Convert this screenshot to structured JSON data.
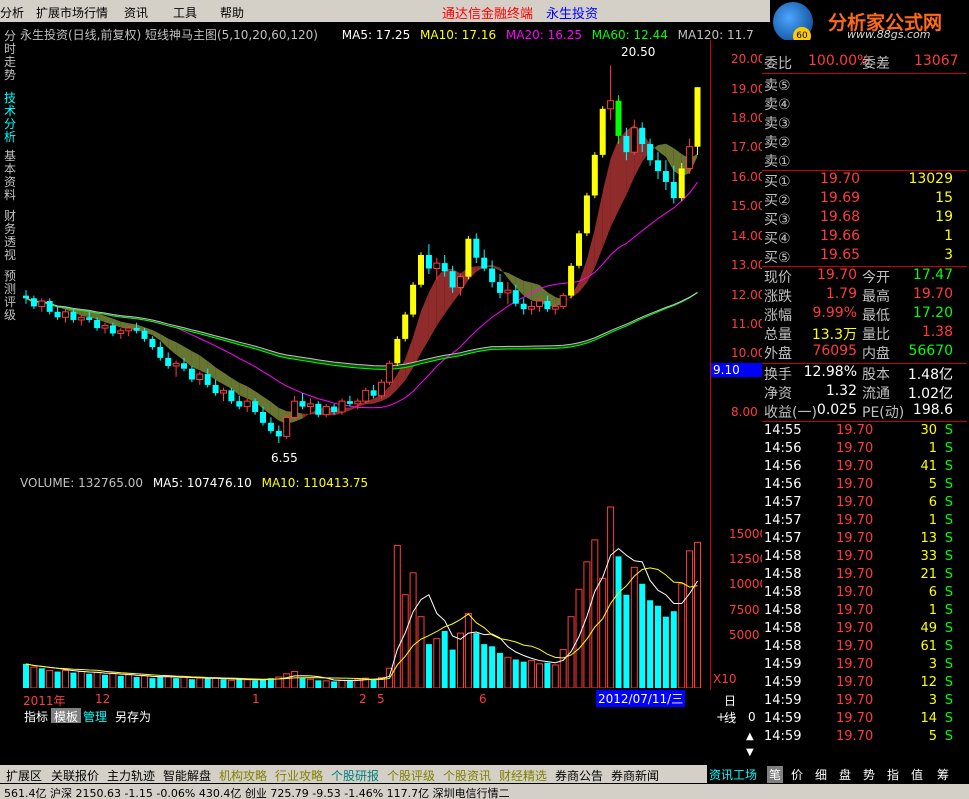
{
  "menu": {
    "items": [
      "分析",
      "扩展市场行情",
      "资讯",
      "工具",
      "帮助"
    ],
    "promo1": "通达信金融终端",
    "promo2": "永生投资"
  },
  "logo": {
    "text": "分析家公式网",
    "url": "www.88gs.com",
    "badge": "60"
  },
  "left_tabs": [
    "分时走势",
    "技术分析",
    "基本资料",
    "财务透视",
    "预测评级"
  ],
  "chart_header": {
    "title": "永生投资(日线,前复权) 短线神马主图(5,10,20,60,120)",
    "ma5": "MA5: 17.25",
    "ma10": "MA10: 17.16",
    "ma20": "MA20: 16.25",
    "ma60": "MA60: 12.44",
    "ma120": "MA120: 11.7",
    "ma_colors": {
      "ma5": "#ffffff",
      "ma10": "#ffff00",
      "ma20": "#ff00ff",
      "ma60": "#00ff00",
      "ma120": "#c0c0c0"
    }
  },
  "annotations": {
    "high": "20.50",
    "low": "6.55"
  },
  "volume_header": {
    "volume": "VOLUME: 132765.00",
    "ma5": "MA5: 107476.10",
    "ma10": "MA10: 110413.75"
  },
  "price_axis": [
    "20.00",
    "19.00",
    "18.00",
    "17.00",
    "16.00",
    "15.00",
    "14.00",
    "13.00",
    "12.00",
    "11.00",
    "10.00",
    "9.10",
    "8.00"
  ],
  "cursor_price": "9.10",
  "volume_axis": [
    "15000",
    "12500",
    "10000",
    "7500",
    "5000",
    "X10"
  ],
  "x_axis": {
    "labels": [
      "2011年",
      "12",
      "1",
      "2",
      "5",
      "6"
    ],
    "cursor_date": "2012/07/11/三",
    "right_label": "日线"
  },
  "indicator_tabs": [
    "指标",
    "模板",
    "管理",
    "另存为"
  ],
  "scroll_controls": [
    "+",
    "-",
    "0"
  ],
  "quote": {
    "wei_bi": {
      "label": "委比",
      "value": "100.00%",
      "label2": "委差",
      "value2": "13067"
    },
    "sell": [
      {
        "label": "卖⑤"
      },
      {
        "label": "卖④"
      },
      {
        "label": "卖③"
      },
      {
        "label": "卖②"
      },
      {
        "label": "卖①"
      }
    ],
    "buy": [
      {
        "label": "买①",
        "price": "19.70",
        "vol": "13029"
      },
      {
        "label": "买②",
        "price": "19.69",
        "vol": "15"
      },
      {
        "label": "买③",
        "price": "19.68",
        "vol": "19"
      },
      {
        "label": "买④",
        "price": "19.66",
        "vol": "1"
      },
      {
        "label": "买⑤",
        "price": "19.65",
        "vol": "3"
      }
    ],
    "stats": [
      {
        "l1": "现价",
        "v1": "19.70",
        "c1": "#ff3c3c",
        "l2": "今开",
        "v2": "17.47",
        "c2": "#00ff00"
      },
      {
        "l1": "涨跌",
        "v1": "1.79",
        "c1": "#ff3c3c",
        "l2": "最高",
        "v2": "19.70",
        "c2": "#ff3c3c"
      },
      {
        "l1": "涨幅",
        "v1": "9.99%",
        "c1": "#ff3c3c",
        "l2": "最低",
        "v2": "17.20",
        "c2": "#00ff00"
      },
      {
        "l1": "总量",
        "v1": "13.3万",
        "c1": "#ffff00",
        "l2": "量比",
        "v2": "1.38",
        "c2": "#ff3c3c"
      },
      {
        "l1": "外盘",
        "v1": "76095",
        "c1": "#ff3c3c",
        "l2": "内盘",
        "v2": "56670",
        "c2": "#00ff00"
      }
    ],
    "fundamentals": [
      {
        "l1": "换手",
        "v1": "12.98%",
        "l2": "股本",
        "v2": "1.48亿"
      },
      {
        "l1": "净资",
        "v1": "1.32",
        "l2": "流通",
        "v2": "1.02亿"
      },
      {
        "l1": "收益(一)",
        "v1": "0.025",
        "l2": "PE(动)",
        "v2": "198.6"
      }
    ],
    "ticks": [
      {
        "time": "14:55",
        "price": "19.70",
        "vol": "30",
        "bs": "S"
      },
      {
        "time": "14:56",
        "price": "19.70",
        "vol": "1",
        "bs": "S"
      },
      {
        "time": "14:56",
        "price": "19.70",
        "vol": "41",
        "bs": "S"
      },
      {
        "time": "14:56",
        "price": "19.70",
        "vol": "5",
        "bs": "S"
      },
      {
        "time": "14:57",
        "price": "19.70",
        "vol": "6",
        "bs": "S"
      },
      {
        "time": "14:57",
        "price": "19.70",
        "vol": "1",
        "bs": "S"
      },
      {
        "time": "14:57",
        "price": "19.70",
        "vol": "13",
        "bs": "S"
      },
      {
        "time": "14:58",
        "price": "19.70",
        "vol": "33",
        "bs": "S"
      },
      {
        "time": "14:58",
        "price": "19.70",
        "vol": "21",
        "bs": "S"
      },
      {
        "time": "14:58",
        "price": "19.70",
        "vol": "6",
        "bs": "S"
      },
      {
        "time": "14:58",
        "price": "19.70",
        "vol": "1",
        "bs": "S"
      },
      {
        "time": "14:58",
        "price": "19.70",
        "vol": "49",
        "bs": "S"
      },
      {
        "time": "14:58",
        "price": "19.70",
        "vol": "61",
        "bs": "S"
      },
      {
        "time": "14:59",
        "price": "19.70",
        "vol": "3",
        "bs": "S"
      },
      {
        "time": "14:59",
        "price": "19.70",
        "vol": "12",
        "bs": "S"
      },
      {
        "time": "14:59",
        "price": "19.70",
        "vol": "3",
        "bs": "S"
      },
      {
        "time": "14:59",
        "price": "19.70",
        "vol": "14",
        "bs": "S"
      },
      {
        "time": "14:59",
        "price": "19.70",
        "vol": "5",
        "bs": "S"
      }
    ]
  },
  "bottom_tabs": [
    "扩展区",
    "关联报价",
    "主力轨迹",
    "智能解盘",
    "机构攻略",
    "行业攻略",
    "个股研报",
    "个股评级",
    "个股资讯",
    "财经精选",
    "券商公告",
    "券商新闻"
  ],
  "right_tabs": [
    "资讯工场",
    "笔",
    "价",
    "细",
    "盘",
    "势",
    "指",
    "值",
    "筹"
  ],
  "status_text": "561.4亿 沪深 2150.63 -1.15 -0.06% 430.4亿 创业 725.79 -9.53 -1.46% 117.7亿 深圳电信行情二",
  "chart_data": {
    "type": "candlestick",
    "ylim": [
      6.0,
      21.0
    ],
    "candles": [
      [
        12.0,
        12.2,
        11.7,
        11.9
      ],
      [
        11.9,
        12.0,
        11.5,
        11.6
      ],
      [
        11.6,
        11.9,
        11.4,
        11.8
      ],
      [
        11.8,
        11.9,
        11.3,
        11.4
      ],
      [
        11.4,
        11.6,
        11.1,
        11.2
      ],
      [
        11.2,
        11.5,
        11.0,
        11.4
      ],
      [
        11.4,
        11.5,
        11.0,
        11.1
      ],
      [
        11.1,
        11.3,
        10.9,
        11.2
      ],
      [
        11.2,
        11.4,
        11.0,
        11.1
      ],
      [
        11.1,
        11.2,
        10.7,
        10.8
      ],
      [
        10.8,
        11.0,
        10.6,
        10.9
      ],
      [
        10.9,
        11.0,
        10.5,
        10.6
      ],
      [
        10.6,
        10.8,
        10.4,
        10.7
      ],
      [
        10.7,
        10.9,
        10.5,
        10.8
      ],
      [
        10.8,
        11.0,
        10.6,
        10.7
      ],
      [
        10.7,
        10.8,
        10.3,
        10.4
      ],
      [
        10.4,
        10.5,
        10.0,
        10.1
      ],
      [
        10.1,
        10.3,
        9.6,
        9.7
      ],
      [
        9.7,
        9.9,
        9.3,
        9.4
      ],
      [
        9.4,
        9.6,
        9.0,
        9.5
      ],
      [
        9.5,
        9.7,
        9.2,
        9.3
      ],
      [
        9.3,
        9.4,
        8.8,
        8.9
      ],
      [
        8.9,
        9.2,
        8.7,
        9.1
      ],
      [
        9.1,
        9.3,
        8.6,
        8.7
      ],
      [
        8.7,
        8.9,
        8.3,
        8.4
      ],
      [
        8.4,
        8.6,
        8.1,
        8.5
      ],
      [
        8.5,
        8.6,
        8.0,
        8.1
      ],
      [
        8.1,
        8.3,
        7.8,
        7.9
      ],
      [
        7.9,
        8.2,
        7.7,
        8.1
      ],
      [
        8.1,
        8.2,
        7.6,
        7.7
      ],
      [
        7.7,
        7.9,
        7.2,
        7.3
      ],
      [
        7.3,
        7.5,
        6.9,
        7.0
      ],
      [
        7.0,
        7.2,
        6.55,
        6.8
      ],
      [
        6.8,
        7.6,
        6.7,
        7.5
      ],
      [
        7.5,
        8.3,
        7.4,
        8.1
      ],
      [
        8.1,
        8.4,
        7.8,
        7.9
      ],
      [
        7.9,
        8.2,
        7.6,
        8.0
      ],
      [
        8.0,
        8.1,
        7.5,
        7.6
      ],
      [
        7.6,
        8.0,
        7.5,
        7.9
      ],
      [
        7.9,
        8.0,
        7.6,
        7.7
      ],
      [
        7.7,
        8.2,
        7.6,
        8.1
      ],
      [
        8.1,
        8.3,
        7.9,
        8.0
      ],
      [
        8.0,
        8.2,
        7.8,
        8.1
      ],
      [
        8.1,
        8.6,
        8.0,
        8.5
      ],
      [
        8.5,
        8.7,
        8.2,
        8.3
      ],
      [
        8.3,
        8.9,
        8.2,
        8.8
      ],
      [
        8.8,
        9.6,
        8.7,
        9.5
      ],
      [
        9.5,
        10.5,
        9.4,
        10.4
      ],
      [
        10.4,
        11.4,
        10.3,
        11.3
      ],
      [
        11.3,
        12.5,
        11.2,
        12.4
      ],
      [
        12.4,
        13.6,
        12.3,
        13.5
      ],
      [
        13.5,
        13.9,
        12.8,
        13.0
      ],
      [
        13.0,
        13.4,
        12.6,
        13.2
      ],
      [
        13.2,
        13.5,
        12.7,
        12.9
      ],
      [
        12.9,
        13.1,
        12.1,
        12.3
      ],
      [
        12.3,
        12.8,
        12.0,
        12.7
      ],
      [
        12.7,
        14.2,
        12.6,
        14.1
      ],
      [
        14.1,
        14.3,
        13.2,
        13.4
      ],
      [
        13.4,
        13.7,
        12.9,
        13.0
      ],
      [
        13.0,
        13.3,
        12.3,
        12.5
      ],
      [
        12.5,
        12.8,
        11.9,
        12.1
      ],
      [
        12.1,
        12.5,
        11.7,
        12.2
      ],
      [
        12.2,
        12.4,
        11.6,
        11.7
      ],
      [
        11.7,
        11.9,
        11.3,
        11.5
      ],
      [
        11.5,
        11.8,
        11.3,
        11.6
      ],
      [
        11.6,
        11.9,
        11.4,
        11.8
      ],
      [
        11.8,
        12.0,
        11.4,
        11.5
      ],
      [
        11.5,
        11.7,
        11.3,
        11.6
      ],
      [
        11.6,
        12.1,
        11.5,
        12.0
      ],
      [
        12.0,
        13.2,
        11.9,
        13.1
      ],
      [
        13.1,
        14.4,
        13.0,
        14.3
      ],
      [
        14.3,
        15.8,
        14.2,
        15.7
      ],
      [
        15.7,
        17.3,
        15.6,
        17.2
      ],
      [
        17.2,
        19.0,
        17.1,
        18.9
      ],
      [
        18.9,
        20.5,
        18.5,
        19.2
      ],
      [
        19.2,
        19.4,
        17.6,
        17.9
      ],
      [
        17.9,
        18.2,
        17.0,
        17.3
      ],
      [
        17.3,
        18.5,
        17.2,
        18.2
      ],
      [
        18.2,
        18.4,
        17.3,
        17.6
      ],
      [
        17.6,
        17.8,
        16.8,
        17.0
      ],
      [
        17.0,
        17.3,
        16.3,
        16.6
      ],
      [
        16.6,
        17.0,
        15.9,
        16.2
      ],
      [
        16.2,
        16.8,
        15.4,
        15.6
      ],
      [
        15.6,
        16.9,
        15.5,
        16.7
      ],
      [
        16.7,
        17.8,
        16.5,
        17.5
      ],
      [
        17.5,
        19.7,
        17.2,
        19.7
      ]
    ],
    "volume": [
      2200,
      1900,
      1800,
      1600,
      1500,
      1600,
      1400,
      1500,
      1300,
      1400,
      1200,
      1300,
      1100,
      1200,
      1000,
      1100,
      900,
      1000,
      1100,
      900,
      1000,
      800,
      900,
      850,
      900,
      800,
      700,
      800,
      750,
      700,
      800,
      900,
      1000,
      1300,
      1500,
      900,
      800,
      700,
      650,
      600,
      700,
      750,
      800,
      900,
      850,
      950,
      1800,
      13000,
      8500,
      10500,
      6500,
      4000,
      4500,
      5200,
      3500,
      5000,
      6800,
      5000,
      4000,
      3800,
      3200,
      2800,
      2600,
      2400,
      2500,
      2200,
      2300,
      2100,
      3500,
      6500,
      9000,
      11500,
      13500,
      10000,
      16500,
      12000,
      8500,
      11000,
      9500,
      8000,
      7500,
      6500,
      7000,
      9500,
      12500,
      13276
    ],
    "volume_up": [
      false,
      true,
      false,
      true,
      false,
      true,
      false,
      true,
      false,
      true,
      false,
      true,
      false,
      true,
      false,
      true,
      false,
      false,
      true,
      false,
      true,
      false,
      true,
      false,
      true,
      false,
      true,
      false,
      true,
      false,
      false,
      false,
      true,
      true,
      true,
      false,
      true,
      false,
      true,
      false,
      true,
      false,
      true,
      true,
      false,
      true,
      true,
      true,
      true,
      true,
      true,
      false,
      true,
      false,
      false,
      true,
      true,
      false,
      false,
      false,
      false,
      true,
      false,
      false,
      true,
      true,
      false,
      true,
      true,
      true,
      true,
      true,
      true,
      true,
      true,
      false,
      false,
      true,
      false,
      false,
      false,
      false,
      false,
      true,
      true,
      true
    ]
  }
}
